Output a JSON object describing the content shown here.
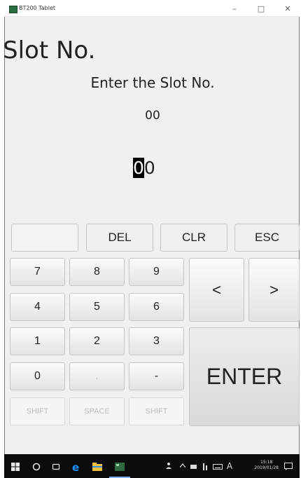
{
  "window": {
    "title": "BT200 Tablet",
    "minimize_glyph": "–",
    "maximize_glyph": "□",
    "close_glyph": "✕"
  },
  "screen": {
    "title": "Slot No.",
    "prompt": "Enter the Slot No.",
    "current_value": "00",
    "entry_cursor_char": "0",
    "entry_rest": "0"
  },
  "keypad": {
    "blank": "",
    "del": "DEL",
    "clr": "CLR",
    "esc": "ESC",
    "k7": "7",
    "k8": "8",
    "k9": "9",
    "k4": "4",
    "k5": "5",
    "k6": "6",
    "k1": "1",
    "k2": "2",
    "k3": "3",
    "k0": "0",
    "dot": ".",
    "minus": "-",
    "left": "<",
    "right": ">",
    "enter": "ENTER",
    "shift_left": "SHIFT",
    "space": "SPACE",
    "shift_right": "SHIFT"
  },
  "taskbar": {
    "time": "15:18",
    "date": "2019/01/28",
    "ime": "A"
  },
  "colors": {
    "background": "#f0f0f0",
    "taskbar": "#0c0c0c",
    "edge_icon": "#1e90ff",
    "app_icon": "#2b6b3f"
  }
}
